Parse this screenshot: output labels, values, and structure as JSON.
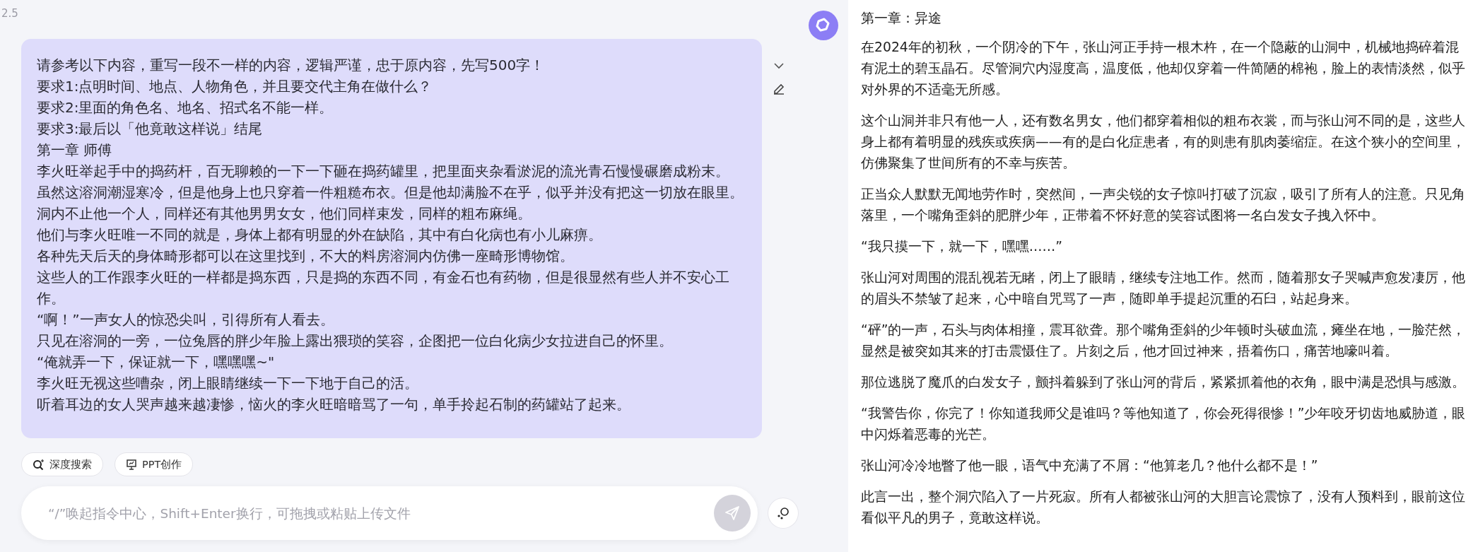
{
  "header": {
    "version": "2.5"
  },
  "user_message": {
    "lines": [
      "请参考以下内容，重写一段不一样的内容，逻辑严谨，忠于原内容，先写500字！",
      "要求1:点明时间、地点、人物角色，并且要交代主角在做什么？",
      "要求2:里面的角色名、地名、招式名不能一样。",
      "要求3:最后以「他竟敢这样说」结尾",
      "第一章 师傅",
      "李火旺举起手中的捣药杆，百无聊赖的一下一下砸在捣药罐里，把里面夹杂看淤泥的流光青石慢慢碾磨成粉末。",
      "虽然这溶洞潮湿寒冷，但是他身上也只穿着一件粗糙布衣。但是他却满脸不在乎，似乎并没有把这一切放在眼里。",
      "洞内不止他一个人，同样还有其他男男女女，他们同样束发，同样的粗布麻绳。",
      "他们与李火旺唯一不同的就是，身体上都有明显的外在缺陷，其中有白化病也有小儿麻痹。",
      "各种先天后天的身体畸形都可以在这里找到，不大的料房溶洞内仿佛一座畸形博物馆。",
      "这些人的工作跟李火旺的一样都是捣东西，只是捣的东西不同，有金石也有药物，但是很显然有些人并不安心工作。",
      "“啊！”一声女人的惊恐尖叫，引得所有人看去。",
      "只见在溶洞的一旁，一位兔唇的胖少年脸上露出猥琐的笑容，企图把一位白化病少女拉进自己的怀里。",
      "“俺就弄一下，保证就一下，嘿嘿嘿~\"",
      "李火旺无视这些嘈杂，闭上眼睛继续一下一下地于自己的活。",
      "听着耳边的女人哭声越来越凄惨，恼火的李火旺暗暗骂了一句，单手拎起石制的药罐站了起来。"
    ]
  },
  "tools": [
    {
      "label": "深度搜索"
    },
    {
      "label": "PPT创作"
    }
  ],
  "composer": {
    "placeholder": "“/”唤起指令中心，Shift+Enter换行，可拖拽或粘贴上传文件",
    "send_disabled": true
  },
  "response": {
    "title": "第一章：异途",
    "paragraphs": [
      "在2024年的初秋，一个阴冷的下午，张山河正手持一根木杵，在一个隐蔽的山洞中，机械地捣碎着混有泥土的碧玉晶石。尽管洞穴内湿度高，温度低，他却仅穿着一件简陋的棉袍，脸上的表情淡然，似乎对外界的不适毫无所感。",
      "这个山洞并非只有他一人，还有数名男女，他们都穿着相似的粗布衣裳，而与张山河不同的是，这些人身上都有着明显的残疾或疾病——有的是白化症患者，有的则患有肌肉萎缩症。在这个狭小的空间里，仿佛聚集了世间所有的不幸与疾苦。",
      "正当众人默默无闻地劳作时，突然间，一声尖锐的女子惊叫打破了沉寂，吸引了所有人的注意。只见角落里，一个嘴角歪斜的肥胖少年，正带着不怀好意的笑容试图将一名白发女子拽入怀中。",
      "“我只摸一下，就一下，嘿嘿……”",
      "张山河对周围的混乱视若无睹，闭上了眼睛，继续专注地工作。然而，随着那女子哭喊声愈发凄厉，他的眉头不禁皱了起来，心中暗自咒骂了一声，随即单手提起沉重的石臼，站起身来。",
      "“砰”的一声，石头与肉体相撞，震耳欲聋。那个嘴角歪斜的少年顿时头破血流，瘫坐在地，一脸茫然，显然是被突如其来的打击震慑住了。片刻之后，他才回过神来，捂着伤口，痛苦地嚎叫着。",
      "那位逃脱了魔爪的白发女子，颤抖着躲到了张山河的背后，紧紧抓着他的衣角，眼中满是恐惧与感激。",
      "“我警告你，你完了！你知道我师父是谁吗？等他知道了，你会死得很惨！”少年咬牙切齿地威胁道，眼中闪烁着恶毒的光芒。",
      "张山河冷冷地瞥了他一眼，语气中充满了不屑：“他算老几？他什么都不是！”",
      "此言一出，整个洞穴陷入了一片死寂。所有人都被张山河的大胆言论震惊了，没有人预料到，眼前这位看似平凡的男子，竟敢这样说。"
    ]
  }
}
